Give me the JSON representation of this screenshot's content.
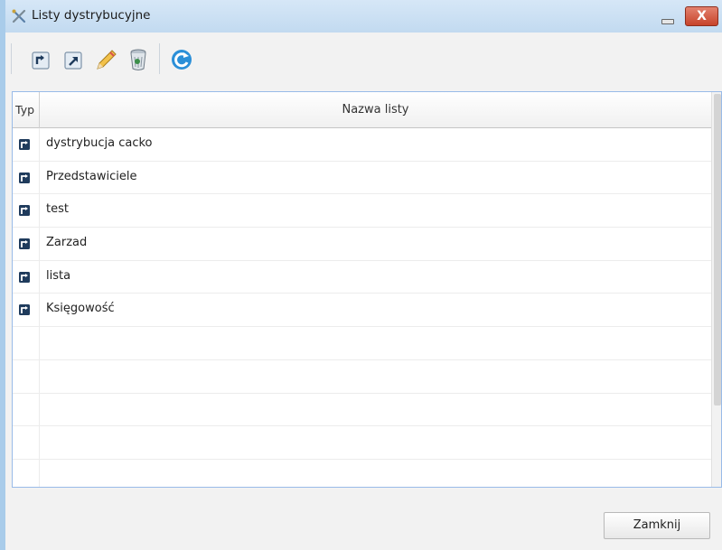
{
  "window": {
    "title": "Listy dystrybucyjne",
    "close_glyph": "X",
    "title_icon": "tools-icon"
  },
  "toolbar": {
    "buttons": [
      {
        "name": "import-icon"
      },
      {
        "name": "export-icon"
      },
      {
        "name": "edit-pencil-icon"
      },
      {
        "name": "trash-icon"
      },
      {
        "name": "refresh-icon"
      }
    ]
  },
  "grid": {
    "columns": [
      "Typ",
      "Nazwa listy"
    ],
    "rows": [
      {
        "type_icon": "list-type-icon",
        "name": "dystrybucja cacko"
      },
      {
        "type_icon": "list-type-icon",
        "name": "Przedstawiciele"
      },
      {
        "type_icon": "list-type-icon",
        "name": "test"
      },
      {
        "type_icon": "list-type-icon",
        "name": "Zarzad"
      },
      {
        "type_icon": "list-type-icon",
        "name": "lista"
      },
      {
        "type_icon": "list-type-icon",
        "name": "Księgowość"
      }
    ],
    "empty_rows": 5
  },
  "footer": {
    "close_label": "Zamknij"
  },
  "colors": {
    "accent": "#a9ccea",
    "close_button": "#c7432a",
    "refresh": "#2b8fd8"
  }
}
